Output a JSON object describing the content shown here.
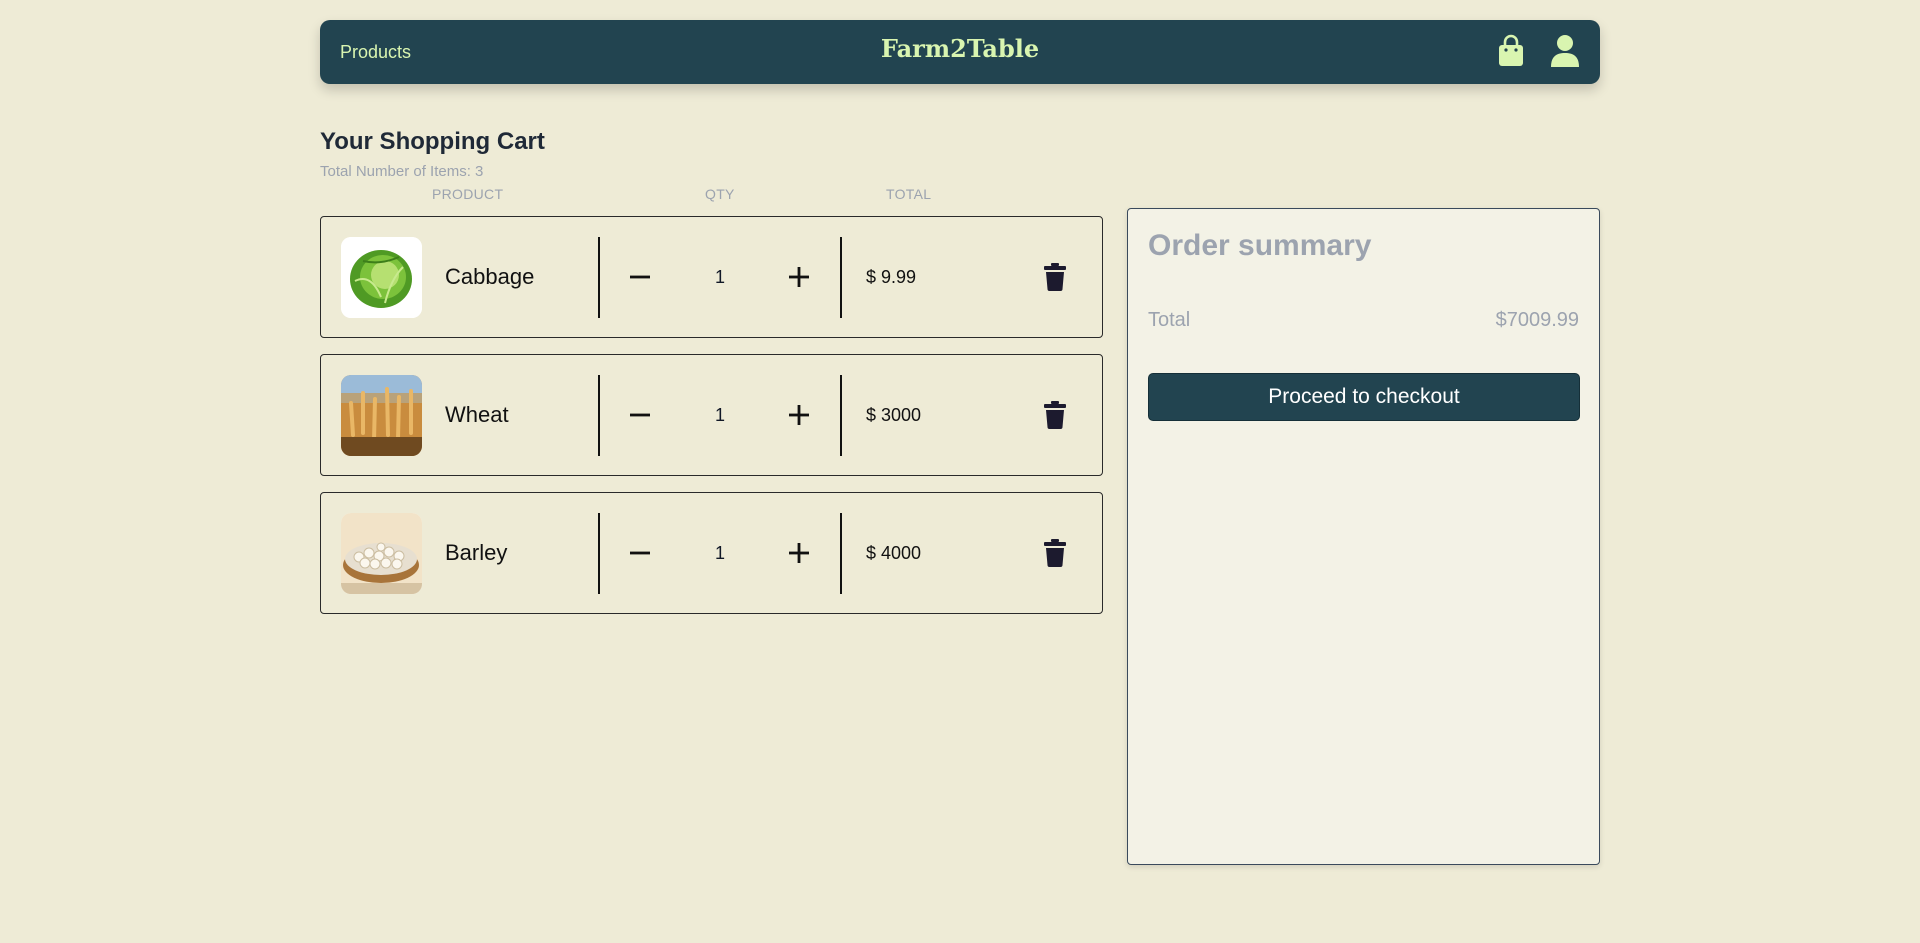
{
  "nav": {
    "products_label": "Products",
    "brand": "Farm2Table",
    "bag_icon": "shopping-bag-icon",
    "user_icon": "user-icon",
    "icon_color": "#d9f5b0",
    "bg_color": "#224450"
  },
  "cart": {
    "title": "Your Shopping Cart",
    "count_text": "Total Number of Items: 3",
    "columns": {
      "product": "PRODUCT",
      "qty": "QTY",
      "total": "TOTAL"
    },
    "items": [
      {
        "name": "Cabbage",
        "qty": "1",
        "total": "$ 9.99",
        "image": "cabbage-image"
      },
      {
        "name": "Wheat",
        "qty": "1",
        "total": "$ 3000",
        "image": "wheat-image"
      },
      {
        "name": "Barley",
        "qty": "1",
        "total": "$ 4000",
        "image": "barley-image"
      }
    ]
  },
  "summary": {
    "title": "Order summary",
    "total_label": "Total",
    "total_value": "$7009.99",
    "checkout_label": "Proceed to checkout"
  }
}
